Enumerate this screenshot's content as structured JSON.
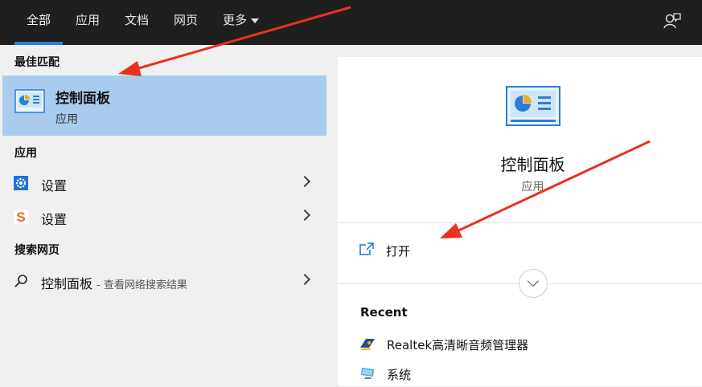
{
  "topbar": {
    "tabs": [
      {
        "label": "全部"
      },
      {
        "label": "应用"
      },
      {
        "label": "文档"
      },
      {
        "label": "网页"
      },
      {
        "label": "更多"
      }
    ],
    "active_tab": "全部"
  },
  "left": {
    "best_match_header": "最佳匹配",
    "best_match": {
      "title": "控制面板",
      "subtitle": "应用"
    },
    "apps_header": "应用",
    "apps": [
      {
        "label": "设置",
        "icon": "gear-icon"
      },
      {
        "label": "设置",
        "icon": "sogou-s-icon"
      }
    ],
    "web_header": "搜索网页",
    "web_result": {
      "label": "控制面板",
      "hint": "- 查看网络搜索结果"
    }
  },
  "right": {
    "title": "控制面板",
    "type": "应用",
    "open_label": "打开",
    "recent_header": "Recent",
    "recent": [
      {
        "label": "Realtek高清晰音频管理器",
        "icon": "realtek-audio-icon"
      },
      {
        "label": "系统",
        "icon": "system-monitor-icon"
      }
    ]
  },
  "colors": {
    "topbar_bg": "#1f1f1f",
    "accent": "#2a7fd5",
    "selected_bg": "#a9cbee",
    "annotation_arrow": "#e8321f"
  }
}
